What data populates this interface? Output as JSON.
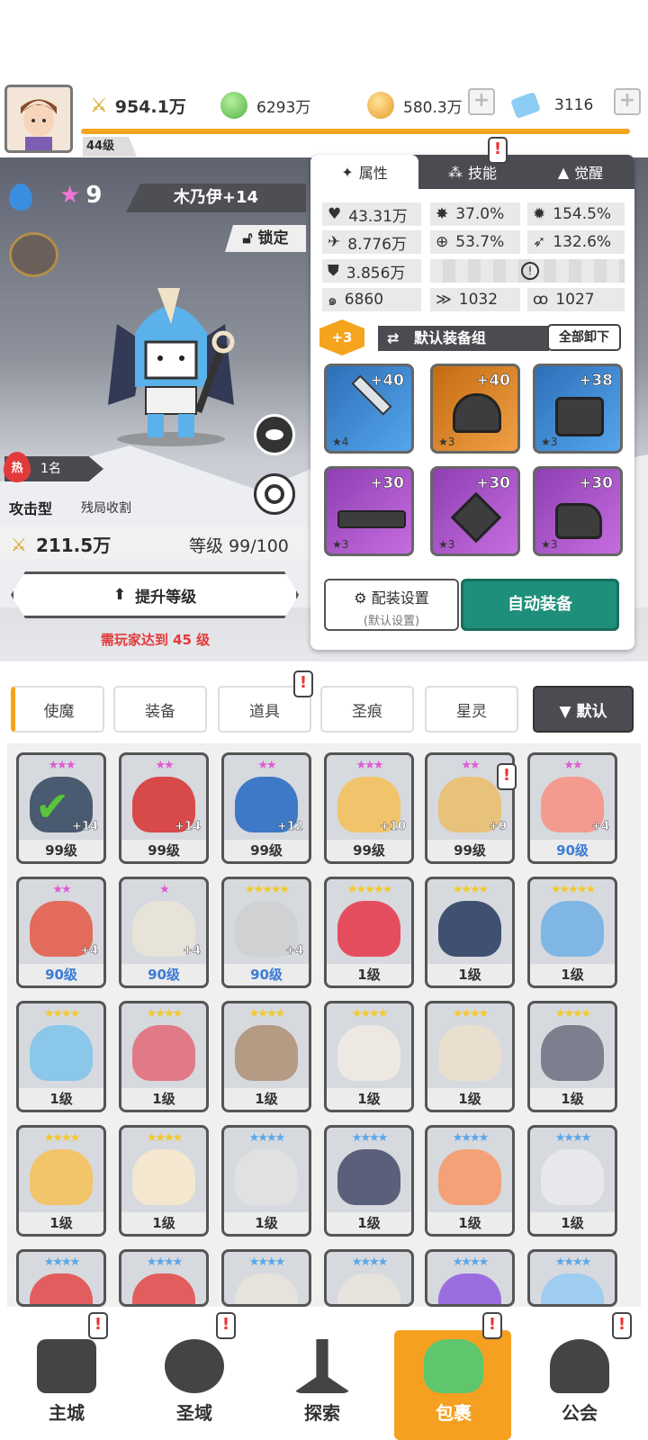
{
  "top": {
    "player_level": "44级",
    "power": "954.1万",
    "currencies": [
      {
        "name": "green-gem",
        "value": "6293万",
        "color": "#6ec85a"
      },
      {
        "name": "gold-coin",
        "value": "580.3万",
        "color": "#f2b244"
      },
      {
        "name": "blue-crystal",
        "value": "3116",
        "color": "#7ec6f5"
      }
    ]
  },
  "hero": {
    "stars": "9",
    "name": "木乃伊+14",
    "lock_label": "锁定",
    "rank_badge": "热",
    "rank": "1名",
    "type": "攻击型",
    "type_desc": "残局收割",
    "power": "211.5万",
    "level_label": "等级 99/100",
    "upgrade_label": "提升等级",
    "requirement": "需玩家达到 45 级"
  },
  "panel": {
    "tabs": [
      "属性",
      "技能",
      "觉醒"
    ],
    "stats": [
      {
        "icon": "heart-icon",
        "value": "43.31万"
      },
      {
        "icon": "burst-icon",
        "value": "37.0%"
      },
      {
        "icon": "sun-icon",
        "value": "154.5%"
      },
      {
        "icon": "sword-icon",
        "value": "8.776万"
      },
      {
        "icon": "target-icon",
        "value": "53.7%"
      },
      {
        "icon": "wing-icon",
        "value": "132.6%"
      },
      {
        "icon": "shield-icon",
        "value": "3.856万"
      },
      {
        "icon": "swirl-icon",
        "value": "6860"
      },
      {
        "icon": "dash-icon",
        "value": "1032"
      },
      {
        "icon": "spiral-icon",
        "value": "1027"
      }
    ],
    "equip_badge": "+3",
    "equip_group": "默认装备组",
    "unequip_all": "全部卸下",
    "equipment": [
      {
        "name": "sword",
        "level": "+40",
        "star": "★4",
        "color": "#3a8bd8"
      },
      {
        "name": "helmet",
        "level": "+40",
        "star": "★3",
        "color": "#e98a2a"
      },
      {
        "name": "armor",
        "level": "+38",
        "star": "★3",
        "color": "#3a8bd8"
      },
      {
        "name": "belt",
        "level": "+30",
        "star": "★3",
        "color": "#a44fc4"
      },
      {
        "name": "amulet",
        "level": "+30",
        "star": "★3",
        "color": "#a44fc4"
      },
      {
        "name": "boots",
        "level": "+30",
        "star": "★3",
        "color": "#a44fc4"
      }
    ],
    "config_label": "配装设置",
    "config_sub": "(默认设置)",
    "auto_equip": "自动装备"
  },
  "category_tabs": [
    "使魔",
    "装备",
    "道具",
    "圣痕",
    "星灵"
  ],
  "sort_label": "▼ 默认",
  "cards": [
    {
      "stars": "★★★",
      "star_color": "#e05ad6",
      "level": "99级",
      "plus": "+14",
      "color": "#4a5a70",
      "checked": true
    },
    {
      "stars": "★★",
      "star_color": "#e05ad6",
      "level": "99级",
      "plus": "+14",
      "color": "#d84a4a"
    },
    {
      "stars": "★★",
      "star_color": "#e05ad6",
      "level": "99级",
      "plus": "+12",
      "color": "#3d79c6"
    },
    {
      "stars": "★★★",
      "star_color": "#e05ad6",
      "level": "99级",
      "plus": "+10",
      "color": "#f1c46c"
    },
    {
      "stars": "★★",
      "star_color": "#e05ad6",
      "level": "99级",
      "plus": "+9",
      "color": "#e8c27a"
    },
    {
      "stars": "★★",
      "star_color": "#e05ad6",
      "level": "90级",
      "plus": "+4",
      "color": "#f49b8f"
    },
    {
      "stars": "★★",
      "star_color": "#e05ad6",
      "level": "90级",
      "plus": "+4",
      "color": "#e36b5c"
    },
    {
      "stars": "★",
      "star_color": "#e05ad6",
      "level": "90级",
      "plus": "+4",
      "color": "#e7e3d8"
    },
    {
      "stars": "★★★★★",
      "star_color": "#f4c92b",
      "level": "90级",
      "plus": "+4",
      "color": "#cfd1d3"
    },
    {
      "stars": "★★★★★",
      "star_color": "#f4c92b",
      "level": "1级",
      "plus": "",
      "color": "#e54d5e"
    },
    {
      "stars": "★★★★",
      "star_color": "#f4c92b",
      "level": "1级",
      "plus": "",
      "color": "#3f5070"
    },
    {
      "stars": "★★★★★",
      "star_color": "#f4c92b",
      "level": "1级",
      "plus": "",
      "color": "#7fb6e3"
    },
    {
      "stars": "★★★★",
      "star_color": "#f4c92b",
      "level": "1级",
      "plus": "",
      "color": "#8ac7e8"
    },
    {
      "stars": "★★★★",
      "star_color": "#f4c92b",
      "level": "1级",
      "plus": "",
      "color": "#e07a86"
    },
    {
      "stars": "★★★★",
      "star_color": "#f4c92b",
      "level": "1级",
      "plus": "",
      "color": "#b59a84"
    },
    {
      "stars": "★★★★",
      "star_color": "#f4c92b",
      "level": "1级",
      "plus": "",
      "color": "#ede8e2"
    },
    {
      "stars": "★★★★",
      "star_color": "#f4c92b",
      "level": "1级",
      "plus": "",
      "color": "#e9dfcf"
    },
    {
      "stars": "★★★★",
      "star_color": "#f4c92b",
      "level": "1级",
      "plus": "",
      "color": "#7b7f8e"
    },
    {
      "stars": "★★★★",
      "star_color": "#f4c92b",
      "level": "1级",
      "plus": "",
      "color": "#f2c56b"
    },
    {
      "stars": "★★★★",
      "star_color": "#f4c92b",
      "level": "1级",
      "plus": "",
      "color": "#f3e7cf"
    },
    {
      "stars": "★★★★",
      "star_color": "#5aa7e8",
      "level": "1级",
      "plus": "",
      "color": "#e1e1e1"
    },
    {
      "stars": "★★★★",
      "star_color": "#5aa7e8",
      "level": "1级",
      "plus": "",
      "color": "#5a5f7a"
    },
    {
      "stars": "★★★★",
      "star_color": "#5aa7e8",
      "level": "1级",
      "plus": "",
      "color": "#f2a276"
    },
    {
      "stars": "★★★★",
      "star_color": "#5aa7e8",
      "level": "1级",
      "plus": "",
      "color": "#e8e8ec"
    },
    {
      "stars": "★★★★",
      "star_color": "#5aa7e8",
      "level": "",
      "plus": "",
      "color": "#e25d5d"
    },
    {
      "stars": "★★★★",
      "star_color": "#5aa7e8",
      "level": "",
      "plus": "",
      "color": "#e25d5d"
    },
    {
      "stars": "★★★★",
      "star_color": "#5aa7e8",
      "level": "",
      "plus": "",
      "color": "#e6e2dc"
    },
    {
      "stars": "★★★★",
      "star_color": "#5aa7e8",
      "level": "",
      "plus": "",
      "color": "#e6e2dc"
    },
    {
      "stars": "★★★★",
      "star_color": "#5aa7e8",
      "level": "",
      "plus": "",
      "color": "#9b6ee0"
    },
    {
      "stars": "★★★★",
      "star_color": "#5aa7e8",
      "level": "",
      "plus": "",
      "color": "#9fcdf0"
    }
  ],
  "nav": [
    {
      "label": "主城",
      "icon": "castle-icon"
    },
    {
      "label": "圣域",
      "icon": "vortex-icon"
    },
    {
      "label": "探索",
      "icon": "sword-stone-icon"
    },
    {
      "label": "包裹",
      "icon": "bag-icon",
      "active": true
    },
    {
      "label": "公会",
      "icon": "guild-icon"
    }
  ]
}
